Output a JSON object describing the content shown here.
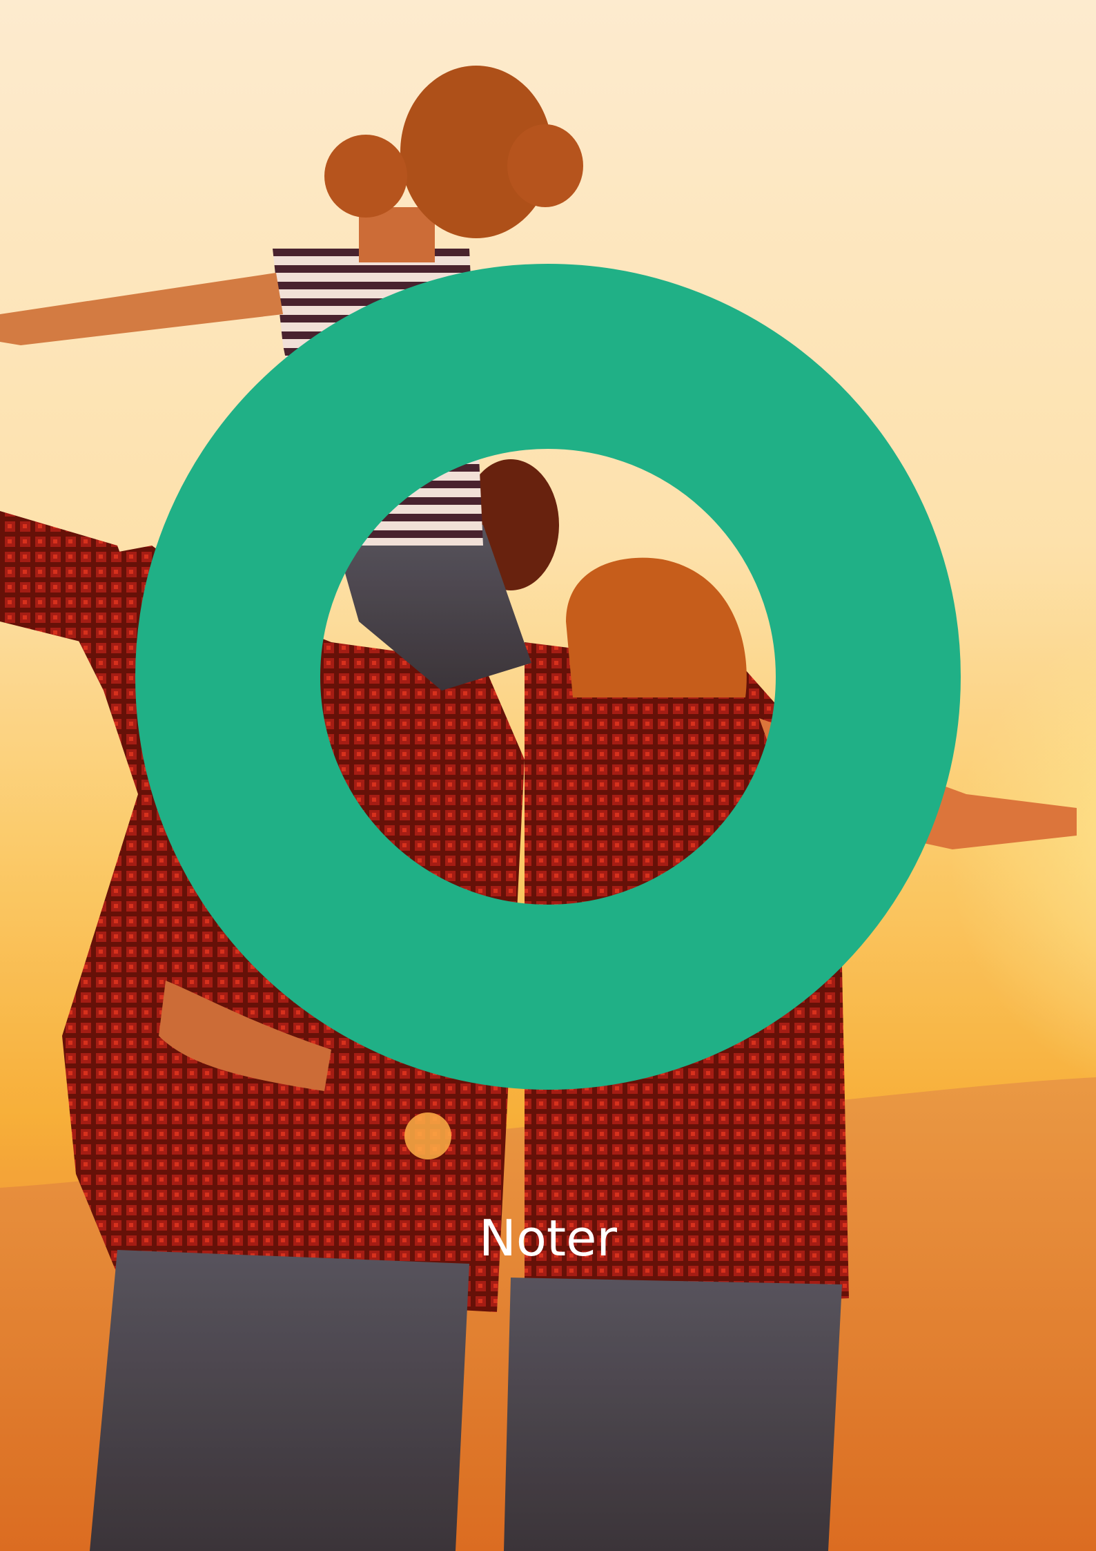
{
  "cover": {
    "title": "Noter",
    "accent_color": "#20b086",
    "photo": "family-sunset-photo"
  }
}
